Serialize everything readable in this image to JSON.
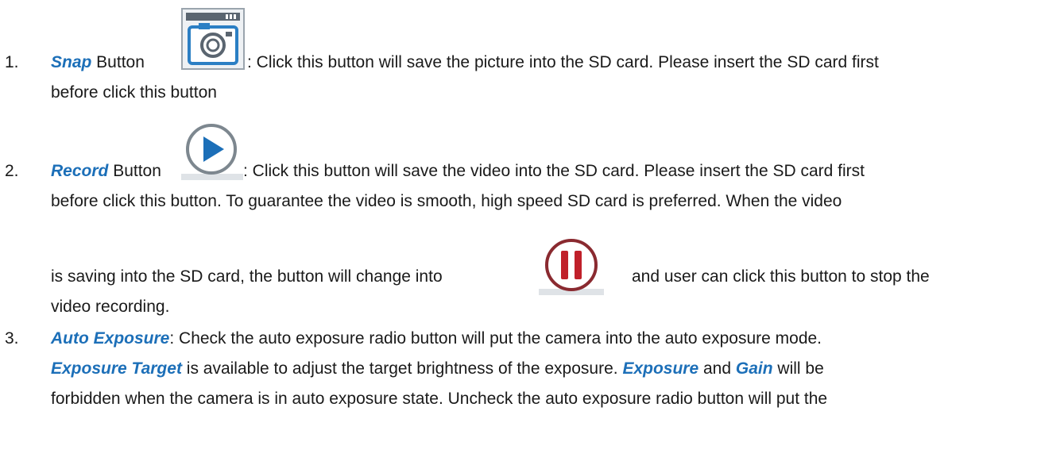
{
  "items": [
    {
      "number": "1.",
      "keyword": "Snap",
      "after_keyword": " Button",
      "icon": "camera-snap-icon",
      "line1_rest": ": Click this button will save the picture into the SD card. Please insert the SD card first",
      "line2": "before click this button"
    },
    {
      "number": "2.",
      "keyword": "Record",
      "after_keyword": " Button",
      "icon": "play-record-icon",
      "line1_rest": ": Click this button will save the video into the SD card. Please insert the SD card first",
      "line2": "before click this button. To guarantee the video is smooth, high speed SD card is preferred. When the video",
      "line3_before": "is saving into the SD card, the button will change into",
      "pause_icon": "pause-stop-icon",
      "line3_after": "and user can click this button to stop the",
      "line4": "video recording."
    },
    {
      "number": "3.",
      "line1_kw": "Auto Exposure",
      "line1_rest": ": Check the auto exposure radio button will put the camera into the auto exposure mode.",
      "line2_kw": "Exposure Target",
      "line2_rest": " is available to adjust the target brightness of the exposure. ",
      "line2_kw2": "Exposure",
      "line2_mid": " and ",
      "line2_kw3": "Gain",
      "line2_end": " will be",
      "line3": "forbidden when the camera is in auto exposure state. Uncheck the auto exposure radio button will put the"
    }
  ],
  "colors": {
    "accent": "#1c6fb8",
    "pause_red": "#c0202a",
    "text": "#1a1a1a"
  }
}
